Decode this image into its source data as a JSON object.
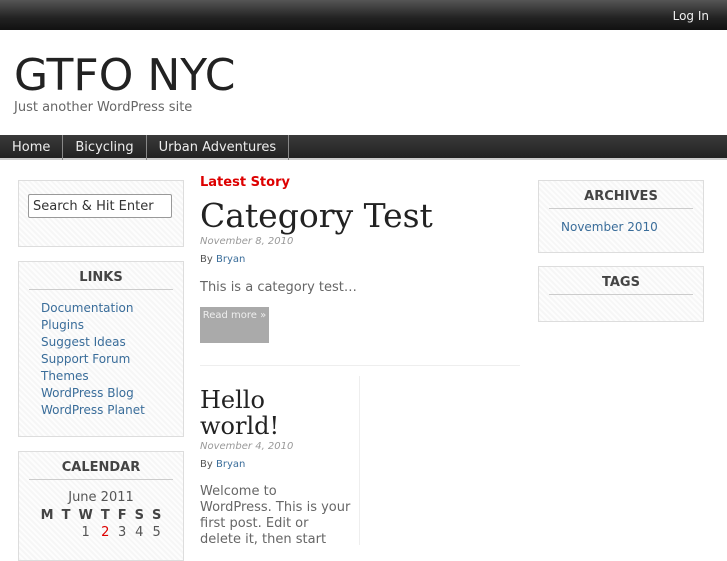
{
  "topbar": {
    "login": "Log In"
  },
  "site": {
    "title": "GTFO NYC",
    "tagline": "Just another WordPress site"
  },
  "nav": [
    "Home",
    "Bicycling",
    "Urban Adventures"
  ],
  "search": {
    "placeholder": "Search & Hit Enter"
  },
  "links": {
    "title": "LINKS",
    "items": [
      "Documentation",
      "Plugins",
      "Suggest Ideas",
      "Support Forum",
      "Themes",
      "WordPress Blog",
      "WordPress Planet"
    ]
  },
  "calendar": {
    "title": "CALENDAR",
    "month": "June 2011",
    "days": [
      "M",
      "T",
      "W",
      "T",
      "F",
      "S",
      "S"
    ],
    "row1": [
      "",
      "",
      "1",
      "2",
      "3",
      "4",
      "5"
    ],
    "highlight_color": "#dd0000"
  },
  "archives": {
    "title": "ARCHIVES",
    "items": [
      "November 2010"
    ]
  },
  "tags": {
    "title": "TAGS"
  },
  "posts": [
    {
      "label": "Latest Story",
      "title": "Category Test",
      "date": "November 8, 2010",
      "by": "By",
      "author": "Bryan",
      "excerpt": "This is a category test…",
      "more": "Read more »"
    },
    {
      "title": "Hello world!",
      "date": "November 4, 2010",
      "by": "By",
      "author": "Bryan",
      "excerpt": "Welcome to WordPress. This is your first post. Edit or delete it, then start"
    }
  ]
}
